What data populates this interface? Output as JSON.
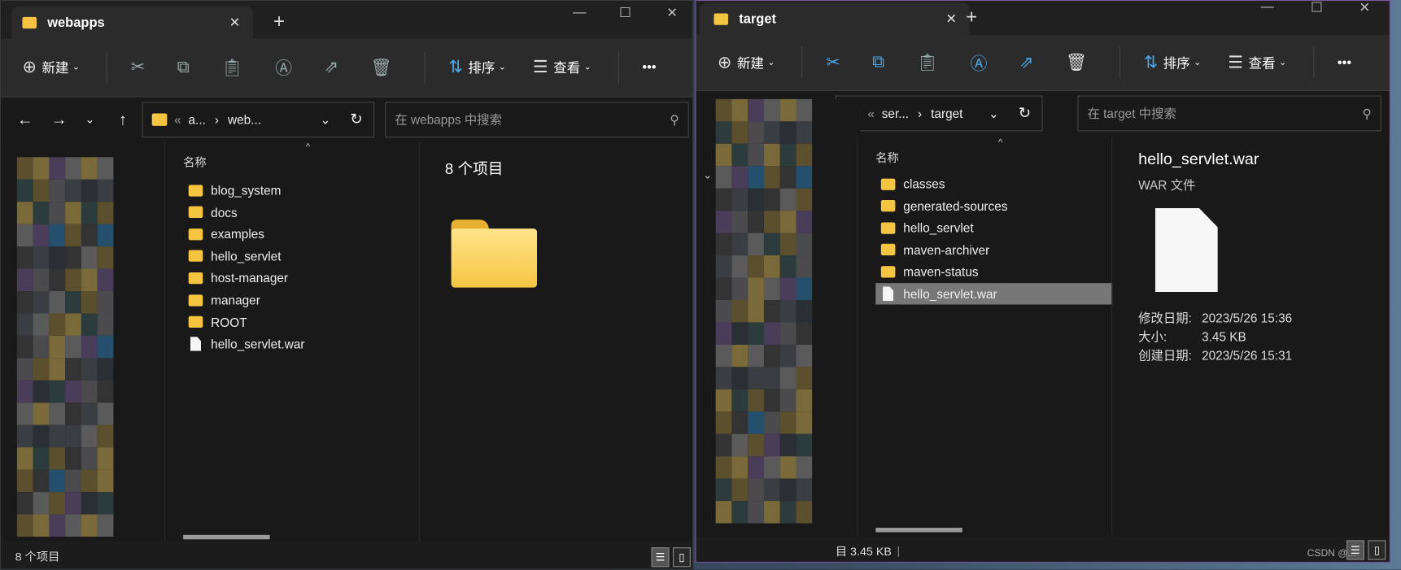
{
  "left": {
    "tab_title": "webapps",
    "toolbar": {
      "new": "新建",
      "sort": "排序",
      "view": "查看",
      "more": "•••"
    },
    "breadcrumb": [
      "a...",
      "web..."
    ],
    "search_placeholder": "在 webapps 中搜索",
    "column_name": "名称",
    "items": [
      {
        "name": "blog_system",
        "type": "folder"
      },
      {
        "name": "docs",
        "type": "folder"
      },
      {
        "name": "examples",
        "type": "folder"
      },
      {
        "name": "hello_servlet",
        "type": "folder"
      },
      {
        "name": "host-manager",
        "type": "folder"
      },
      {
        "name": "manager",
        "type": "folder"
      },
      {
        "name": "ROOT",
        "type": "folder"
      },
      {
        "name": "hello_servlet.war",
        "type": "file"
      }
    ],
    "details_title": "8 个项目",
    "status": "8 个项目"
  },
  "right": {
    "tab_title": "target",
    "toolbar": {
      "new": "新建",
      "sort": "排序",
      "view": "查看",
      "more": "•••"
    },
    "breadcrumb": [
      "ser...",
      "target"
    ],
    "search_placeholder": "在 target 中搜索",
    "column_name": "名称",
    "items": [
      {
        "name": "classes",
        "type": "folder"
      },
      {
        "name": "generated-sources",
        "type": "folder"
      },
      {
        "name": "hello_servlet",
        "type": "folder"
      },
      {
        "name": "maven-archiver",
        "type": "folder"
      },
      {
        "name": "maven-status",
        "type": "folder"
      },
      {
        "name": "hello_servlet.war",
        "type": "file",
        "selected": true
      }
    ],
    "details": {
      "name": "hello_servlet.war",
      "type": "WAR 文件",
      "modified_label": "修改日期:",
      "modified": "2023/5/26 15:36",
      "size_label": "大小:",
      "size": "3.45 KB",
      "created_label": "创建日期:",
      "created": "2023/5/26 15:31"
    },
    "status_selected": "目 3.45 KB"
  },
  "watermark": "CSDN @...",
  "colors": {
    "folder": "#f5c542",
    "accent": "#4aa8e8",
    "selection": "#777777"
  }
}
